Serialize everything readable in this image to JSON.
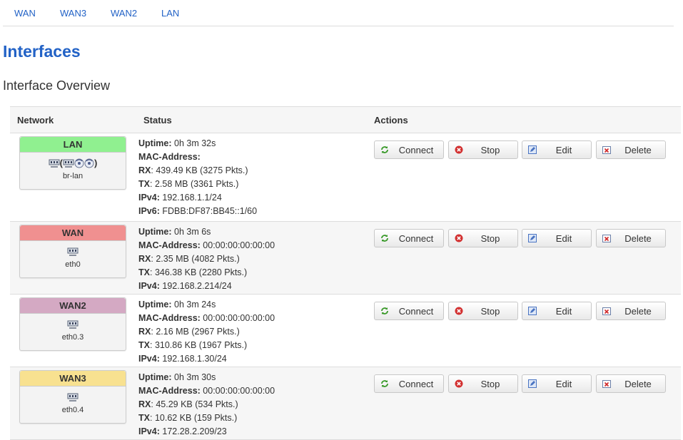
{
  "tabs": [
    "WAN",
    "WAN3",
    "WAN2",
    "LAN"
  ],
  "page_title": "Interfaces",
  "section_title": "Interface Overview",
  "table_headers": {
    "network": "Network",
    "status": "Status",
    "actions": "Actions"
  },
  "labels": {
    "uptime": "Uptime:",
    "mac": "MAC-Address:",
    "rx": "RX",
    "tx": "TX",
    "ipv4": "IPv4:",
    "ipv6": "IPv6:"
  },
  "actions": {
    "connect": "Connect",
    "stop": "Stop",
    "edit": "Edit",
    "delete": "Delete"
  },
  "colors": {
    "LAN": "#90f090",
    "WAN": "#f09090",
    "WAN2": "#d4a9c3",
    "WAN3": "#f8e190",
    "link": "#2262c6"
  },
  "interfaces": [
    {
      "name": "LAN",
      "device": "br-lan",
      "icon": "bridge-icon",
      "uptime": "0h 3m 32s",
      "mac": "",
      "rx": "439.49 KB (3275 Pkts.)",
      "tx": "2.58 MB (3361 Pkts.)",
      "ipv4": "192.168.1.1/24",
      "ipv6": "FDBB:DF87:BB45::1/60"
    },
    {
      "name": "WAN",
      "device": "eth0",
      "icon": "ethernet-icon",
      "uptime": "0h 3m 6s",
      "mac": "00:00:00:00:00:00",
      "rx": "2.35 MB (4082 Pkts.)",
      "tx": "346.38 KB (2280 Pkts.)",
      "ipv4": "192.168.2.214/24"
    },
    {
      "name": "WAN2",
      "device": "eth0.3",
      "icon": "ethernet-icon",
      "uptime": "0h 3m 24s",
      "mac": "00:00:00:00:00:00",
      "rx": "2.16 MB (2967 Pkts.)",
      "tx": "310.86 KB (1967 Pkts.)",
      "ipv4": "192.168.1.30/24"
    },
    {
      "name": "WAN3",
      "device": "eth0.4",
      "icon": "ethernet-icon",
      "uptime": "0h 3m 30s",
      "mac": "00:00:00:00:00:00",
      "rx": "45.29 KB (534 Pkts.)",
      "tx": "10.62 KB (159 Pkts.)",
      "ipv4": "172.28.2.209/23"
    }
  ]
}
